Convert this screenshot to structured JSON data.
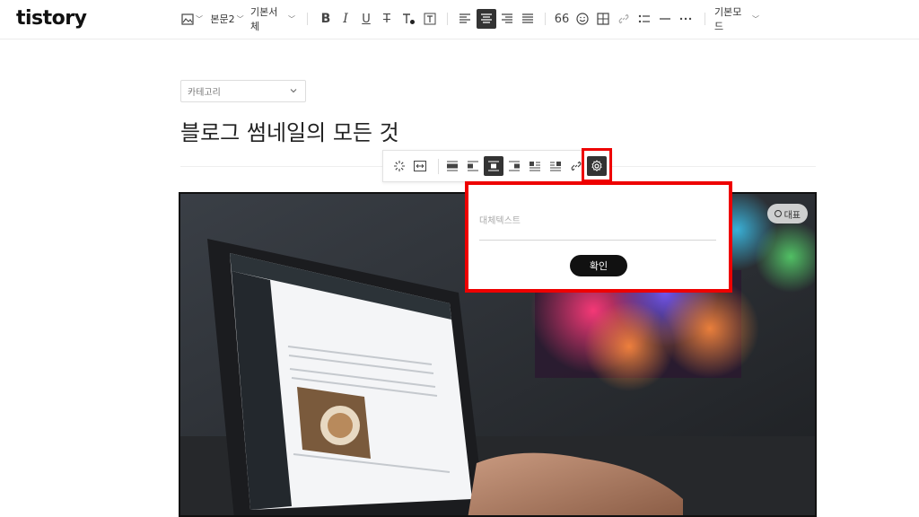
{
  "app": {
    "logo": "tistory"
  },
  "toolbar": {
    "paragraph_style": "본문2",
    "font": "기본서체",
    "quote_label": "66",
    "mode": "기본모드"
  },
  "editor": {
    "category_placeholder": "카테고리",
    "title": "블로그 썸네일의 모든 것"
  },
  "image": {
    "representative_badge": "대표"
  },
  "alt_popover": {
    "placeholder": "대체텍스트",
    "value": "",
    "confirm_label": "확인"
  },
  "colors": {
    "highlight": "#e00000",
    "active_button": "#333333"
  }
}
